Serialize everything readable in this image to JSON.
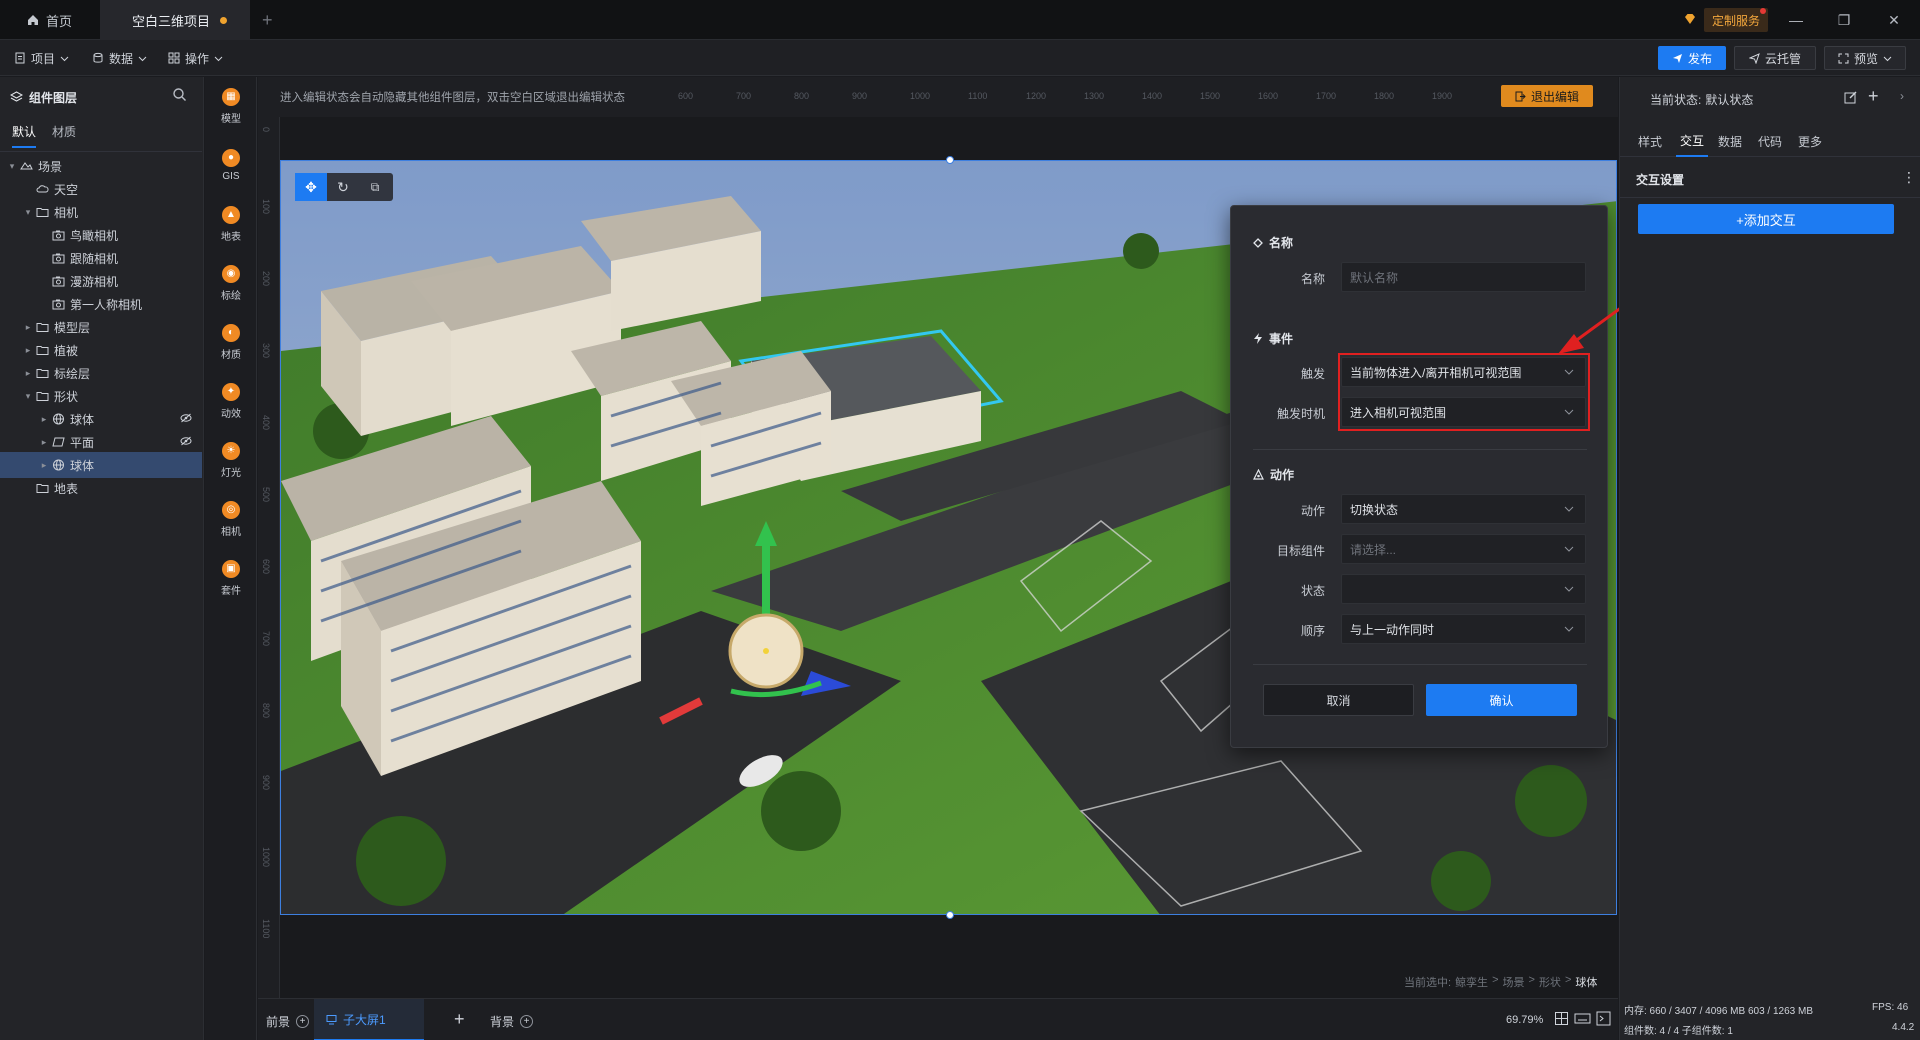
{
  "tabs": [
    {
      "label": "首页"
    },
    {
      "label": "空白三维项目"
    }
  ],
  "titlebar": {
    "custom_service": "定制服务"
  },
  "toolbar": {
    "menus": [
      {
        "label": "项目"
      },
      {
        "label": "数据"
      },
      {
        "label": "操作"
      }
    ],
    "publish": "发布",
    "cloud_host": "云托管",
    "preview": "预览"
  },
  "left_panel": {
    "title": "组件图层",
    "tabs": [
      {
        "label": "默认"
      },
      {
        "label": "材质"
      }
    ],
    "tree": [
      {
        "label": "场景",
        "level": 0,
        "expanded": true,
        "icon": "scene-icon"
      },
      {
        "label": "天空",
        "level": 1,
        "icon": "sky-icon"
      },
      {
        "label": "相机",
        "level": 1,
        "expanded": true,
        "icon": "folder-icon"
      },
      {
        "label": "鸟瞰相机",
        "level": 2,
        "icon": "camera-icon"
      },
      {
        "label": "跟随相机",
        "level": 2,
        "icon": "camera-icon"
      },
      {
        "label": "漫游相机",
        "level": 2,
        "icon": "camera-icon"
      },
      {
        "label": "第一人称相机",
        "level": 2,
        "icon": "camera-icon"
      },
      {
        "label": "模型层",
        "level": 1,
        "collapsed": true,
        "icon": "folder-icon"
      },
      {
        "label": "植被",
        "level": 1,
        "collapsed": true,
        "icon": "folder-icon"
      },
      {
        "label": "标绘层",
        "level": 1,
        "collapsed": true,
        "icon": "folder-icon"
      },
      {
        "label": "形状",
        "level": 1,
        "expanded": true,
        "icon": "folder-icon"
      },
      {
        "label": "球体",
        "level": 2,
        "collapsed": true,
        "icon": "globe-icon",
        "hidden": true
      },
      {
        "label": "平面",
        "level": 2,
        "collapsed": true,
        "icon": "plane-icon",
        "hidden": true
      },
      {
        "label": "球体",
        "level": 2,
        "collapsed": true,
        "icon": "globe-icon",
        "selected": true
      },
      {
        "label": "地表",
        "level": 1,
        "icon": "folder-icon"
      }
    ]
  },
  "components": [
    {
      "label": "模型",
      "icon": "model-icon"
    },
    {
      "label": "GIS",
      "icon": "gis-icon"
    },
    {
      "label": "地表",
      "icon": "terrain-icon"
    },
    {
      "label": "标绘",
      "icon": "marker-icon"
    },
    {
      "label": "材质",
      "icon": "material-icon"
    },
    {
      "label": "动效",
      "icon": "effect-icon"
    },
    {
      "label": "灯光",
      "icon": "light-icon"
    },
    {
      "label": "相机",
      "icon": "camera-icon"
    },
    {
      "label": "套件",
      "icon": "kit-icon"
    }
  ],
  "canvas": {
    "hint": "进入编辑状态会自动隐藏其他组件图层，双击空白区域退出编辑状态",
    "exit_edit": "退出编辑",
    "ruler_top": [
      "600",
      "700",
      "800",
      "900",
      "1000",
      "1100",
      "1200",
      "1300",
      "1400",
      "1500",
      "1600",
      "1700",
      "1800",
      "1900"
    ],
    "ruler_left": [
      "0",
      "100",
      "200",
      "300",
      "400",
      "500",
      "600",
      "700",
      "800",
      "900",
      "1000",
      "1100"
    ],
    "breadcrumb_prefix": "当前选中:",
    "breadcrumb": [
      "鲸孪生",
      "场景",
      "形状"
    ],
    "breadcrumb_current": "球体"
  },
  "bottom": {
    "foreground": "前景",
    "sub_screen": "子大屏1",
    "background": "背景",
    "zoom": "69.79%"
  },
  "right_panel": {
    "state_label": "当前状态:",
    "state_value": "默认状态",
    "tabs": [
      {
        "label": "样式"
      },
      {
        "label": "交互"
      },
      {
        "label": "数据"
      },
      {
        "label": "代码"
      },
      {
        "label": "更多"
      }
    ],
    "section_title": "交互设置",
    "add_interaction": "+添加交互"
  },
  "dialog": {
    "name_section": "名称",
    "name_label": "名称",
    "name_placeholder": "默认名称",
    "event_section": "事件",
    "trigger_label": "触发",
    "trigger_value": "当前物体进入/离开相机可视范围",
    "timing_label": "触发时机",
    "timing_value": "进入相机可视范围",
    "action_section": "动作",
    "action_label": "动作",
    "action_value": "切换状态",
    "target_label": "目标组件",
    "target_placeholder": "请选择...",
    "state_label": "状态",
    "state_value": "",
    "order_label": "顺序",
    "order_value": "与上一动作同时",
    "cancel": "取消",
    "confirm": "确认"
  },
  "status": {
    "memory": "内存: 660 / 3407 / 4096 MB  603 / 1263 MB",
    "fps": "FPS: 46",
    "components": "组件数: 4 / 4  子组件数: 1",
    "version": "4.4.2"
  },
  "colors": {
    "accent": "#1d7bf2",
    "warning": "#f0a32f",
    "highlight_box": "#e02020",
    "arrow": "#e02020"
  }
}
